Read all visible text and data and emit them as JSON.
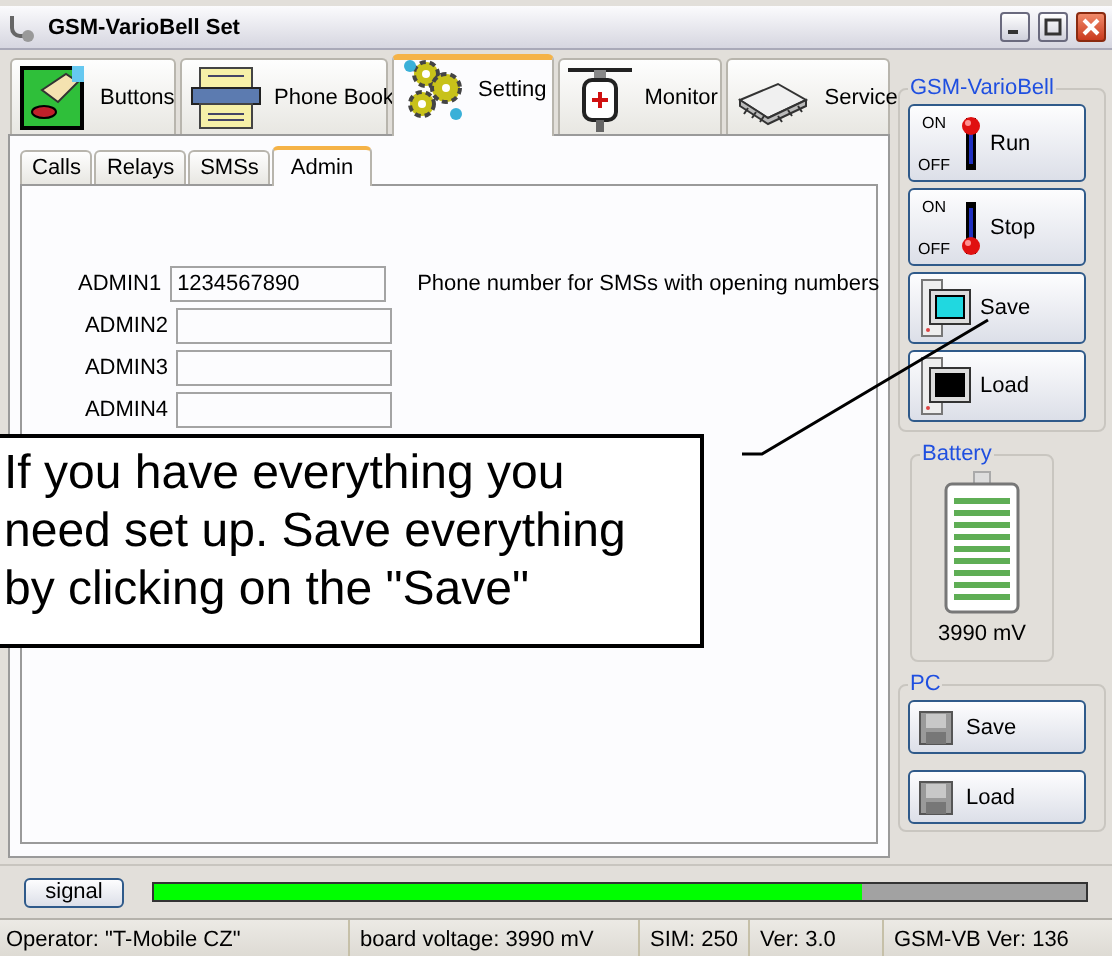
{
  "window": {
    "title": "GSM-VarioBell Set"
  },
  "main_tabs": [
    {
      "kind": "buttons",
      "label": "Buttons",
      "selected": false
    },
    {
      "kind": "phonebook",
      "label": "Phone Book",
      "selected": false
    },
    {
      "kind": "setting",
      "label": "Setting",
      "selected": true
    },
    {
      "kind": "monitor",
      "label": "Monitor",
      "selected": false
    },
    {
      "kind": "service",
      "label": "Service",
      "selected": false
    }
  ],
  "sub_tabs": [
    {
      "label": "Calls",
      "selected": false
    },
    {
      "label": "Relays",
      "selected": false
    },
    {
      "label": "SMSs",
      "selected": false
    },
    {
      "label": "Admin",
      "selected": true
    }
  ],
  "admin_fields": [
    {
      "label": "ADMIN1",
      "value": "1234567890",
      "hint": "Phone number for SMSs with opening numbers"
    },
    {
      "label": "ADMIN2"
    },
    {
      "label": "ADMIN3"
    },
    {
      "label": "ADMIN4"
    }
  ],
  "device_panel": {
    "title": "GSM-VarioBell",
    "buttons": [
      {
        "kind": "run",
        "label": "Run",
        "on_label": "ON",
        "off_label": "OFF"
      },
      {
        "kind": "stop",
        "label": "Stop",
        "on_label": "ON",
        "off_label": "OFF"
      },
      {
        "kind": "save",
        "label": "Save"
      },
      {
        "kind": "load",
        "label": "Load"
      }
    ]
  },
  "battery": {
    "title": "Battery",
    "reading": "3990 mV"
  },
  "pc_panel": {
    "title": "PC",
    "buttons": [
      {
        "label": "Save"
      },
      {
        "label": "Load"
      }
    ]
  },
  "signal": {
    "label": "signal",
    "level": 0.76
  },
  "status_bar": [
    "Operator: \"T-Mobile CZ\"",
    "board voltage: 3990 mV",
    "SIM: 250",
    "Ver: 3.0",
    "GSM-VB Ver: 136"
  ],
  "callout": {
    "text": "If you have everything you need set up. Save everything by clicking on the \"Save\""
  }
}
